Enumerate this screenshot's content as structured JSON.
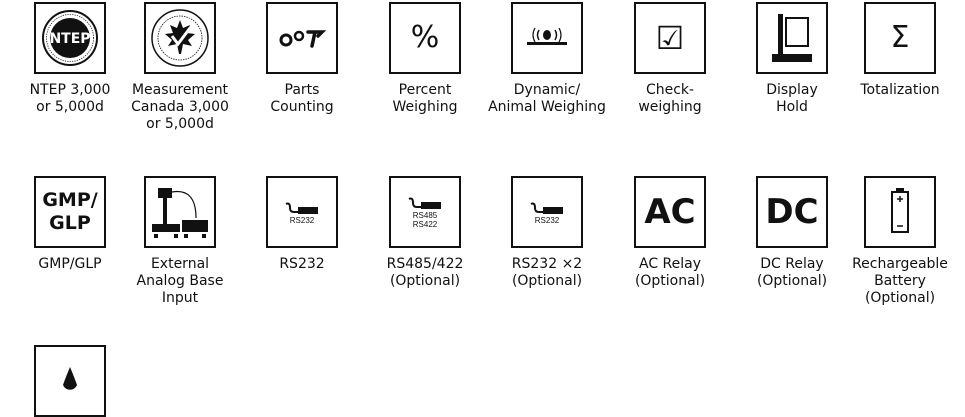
{
  "icons": {
    "ntep": {
      "caption_lines": [
        "NTEP 3,000",
        "or 5,000d"
      ],
      "logo_text": "NTEP"
    },
    "measurement_canada": {
      "caption_lines": [
        "Measurement",
        "Canada 3,000",
        "or 5,000d"
      ]
    },
    "parts_counting": {
      "caption_lines": [
        "Parts",
        "Counting"
      ]
    },
    "percent_weighing": {
      "caption_lines": [
        "Percent",
        "Weighing"
      ],
      "symbol": "%"
    },
    "dynamic_weighing": {
      "caption_lines": [
        "Dynamic/",
        "Animal Weighing"
      ]
    },
    "checkweighing": {
      "caption_lines": [
        "Check-",
        "weighing"
      ],
      "symbol": "☑"
    },
    "display_hold": {
      "caption_lines": [
        "Display",
        "Hold"
      ]
    },
    "totalization": {
      "caption_lines": [
        "Totalization"
      ],
      "symbol": "Σ"
    },
    "gmp_glp": {
      "caption_lines": [
        "GMP/GLP"
      ],
      "symbol_lines": [
        "GMP/",
        "GLP"
      ]
    },
    "external_base": {
      "caption_lines": [
        "External",
        "Analog Base",
        "Input"
      ]
    },
    "rs232": {
      "caption_lines": [
        "RS232"
      ],
      "port_labels": [
        "RS232"
      ]
    },
    "rs485_422": {
      "caption_lines": [
        "RS485/422",
        "(Optional)"
      ],
      "port_labels": [
        "RS485",
        "RS422"
      ]
    },
    "rs232_x2": {
      "caption_lines": [
        "RS232 ×2",
        "(Optional)"
      ],
      "port_labels": [
        "RS232"
      ]
    },
    "ac_relay": {
      "caption_lines": [
        "AC Relay",
        "(Optional)"
      ],
      "symbol": "AC"
    },
    "dc_relay": {
      "caption_lines": [
        "DC Relay",
        "(Optional)"
      ],
      "symbol": "DC"
    },
    "rechargeable_battery": {
      "caption_lines": [
        "Rechargeable",
        "Battery",
        "(Optional)"
      ]
    },
    "washdown": {
      "caption_lines": []
    }
  }
}
